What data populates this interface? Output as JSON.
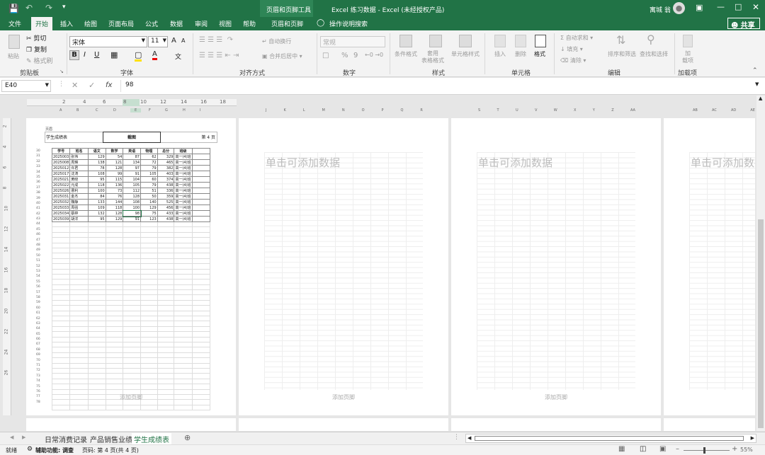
{
  "titlebar": {
    "context_title": "页眉和页脚工具",
    "doc_title": "Excel 练习数据  -  Excel (未经授权产品)",
    "user": "寓城 翁"
  },
  "tabs": [
    "文件",
    "开始",
    "插入",
    "绘图",
    "页面布局",
    "公式",
    "数据",
    "审阅",
    "视图",
    "帮助",
    "页眉和页脚",
    "操作说明搜索"
  ],
  "share_label": "共享",
  "ribbon": {
    "clipboard": {
      "paste": "粘贴",
      "cut": "剪切",
      "copy": "复制",
      "format_painter": "格式刷",
      "label": "剪贴板"
    },
    "font": {
      "name": "宋体",
      "size": "11",
      "grow": "A",
      "shrink": "A",
      "bold": "B",
      "italic": "I",
      "underline": "U",
      "wen": "文",
      "label": "字体"
    },
    "alignment": {
      "wrap": "自动换行",
      "merge": "合并后居中",
      "label": "对齐方式"
    },
    "number": {
      "format": "常规",
      "percent": "%",
      "comma": "9",
      "label": "数字"
    },
    "styles": {
      "conditional": "条件格式",
      "table_format": "套用\n表格格式",
      "cell_styles": "单元格样式",
      "label": "样式"
    },
    "cells": {
      "insert": "插入",
      "delete": "删除",
      "format": "格式",
      "label": "单元格"
    },
    "editing": {
      "autosum": "自动求和",
      "fill": "填充",
      "clear": "清除",
      "sort": "排序和筛选",
      "find": "查找和选择",
      "label": "编辑"
    },
    "addins": {
      "addin": "加\n载项",
      "label": "加载项"
    }
  },
  "formula": {
    "namebox": "E40",
    "value": "98",
    "fx": "fx"
  },
  "ruler": {
    "h_numbers": [
      "2",
      "4",
      "6",
      "8",
      "10",
      "12",
      "14",
      "16",
      "18"
    ],
    "cols_page1": [
      "A",
      "B",
      "C",
      "D",
      "E",
      "F",
      "G",
      "H",
      "I"
    ],
    "cols_page2": [
      "J",
      "K",
      "L",
      "M",
      "N",
      "O",
      "P",
      "Q",
      "R"
    ],
    "cols_page3": [
      "S",
      "T",
      "U",
      "V",
      "W",
      "X",
      "Y",
      "Z",
      "AA"
    ],
    "cols_page4": [
      "AB",
      "AC",
      "AD",
      "AE"
    ],
    "v_numbers": [
      "2",
      "4",
      "6",
      "8",
      "10",
      "12",
      "14",
      "16",
      "18",
      "20",
      "22",
      "24",
      "26"
    ]
  },
  "page1": {
    "header_small": "页眉",
    "header_left": "学生成绩表",
    "header_center": "截图",
    "header_right": "第 4 页",
    "row_numbers": [
      "30",
      "31",
      "32",
      "33",
      "34",
      "35",
      "36",
      "37",
      "38",
      "39",
      "40",
      "41",
      "42",
      "43",
      "44",
      "45",
      "46",
      "47",
      "48",
      "49",
      "50",
      "51",
      "52",
      "53",
      "54",
      "55",
      "56",
      "57",
      "58",
      "59",
      "60",
      "61",
      "62",
      "63",
      "64",
      "65",
      "66",
      "67",
      "68",
      "69",
      "70",
      "71",
      "72",
      "73",
      "74",
      "75",
      "76",
      "77",
      "78"
    ],
    "columns": [
      "学号",
      "姓名",
      "语文",
      "数学",
      "英语",
      "物理",
      "总分",
      "班级"
    ],
    "rows": [
      [
        "2025003",
        "张伟",
        "129",
        "54",
        "87",
        "62",
        "329",
        "高一(4)班"
      ],
      [
        "2025008",
        "周琳",
        "138",
        "121",
        "134",
        "72",
        "465",
        "高一(4)班"
      ],
      [
        "2025012",
        "许君",
        "78",
        "128",
        "97",
        "79",
        "382",
        "高一(4)班"
      ],
      [
        "2025017",
        "沈涛",
        "108",
        "99",
        "91",
        "105",
        "403",
        "高一(4)班"
      ],
      [
        "2025021",
        "黄晓",
        "95",
        "115",
        "104",
        "60",
        "374",
        "高一(4)班"
      ],
      [
        "2025022",
        "元成",
        "118",
        "136",
        "105",
        "79",
        "438",
        "高一(4)班"
      ],
      [
        "2025026",
        "曹利",
        "100",
        "73",
        "112",
        "51",
        "336",
        "高一(4)班"
      ],
      [
        "2025031",
        "金杰",
        "84",
        "76",
        "128",
        "50",
        "359",
        "高一(4)班"
      ],
      [
        "2025032",
        "魏静",
        "133",
        "144",
        "108",
        "140",
        "525",
        "高一(4)班"
      ],
      [
        "2025033",
        "周强",
        "109",
        "118",
        "100",
        "129",
        "456",
        "高一(4)班"
      ],
      [
        "2025034",
        "蔡婷",
        "132",
        "128",
        "98",
        "75",
        "433",
        "高一(4)班"
      ],
      [
        "2025039",
        "胡洋",
        "95",
        "129",
        "91",
        "123",
        "438",
        "高一(4)班"
      ]
    ]
  },
  "placeholder": "单击可添加数据",
  "footer_hint": "添加页脚",
  "sheets": [
    "日常消费记录",
    "产品销售业绩",
    "学生成绩表"
  ],
  "status": {
    "ready": "就绪",
    "accessibility": "辅助功能: 调查",
    "page": "页码: 第 4 页(共 4 页)",
    "zoom": "55%"
  },
  "colors": {
    "brand": "#217346"
  }
}
